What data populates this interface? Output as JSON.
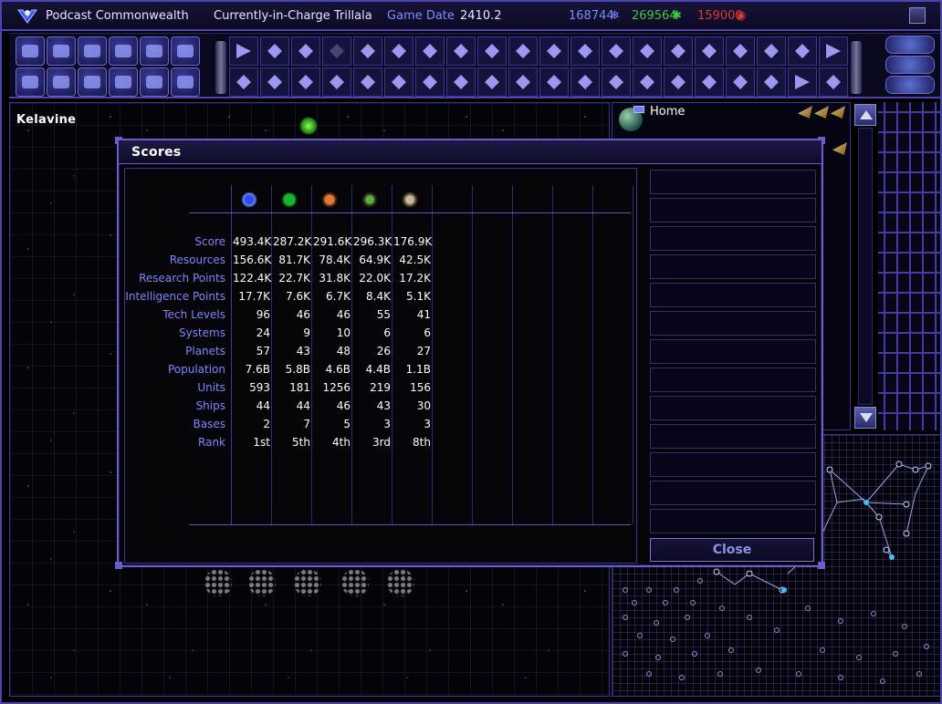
{
  "topbar": {
    "empire_name": "Podcast Commonwealth",
    "leader": "Currently-in-Charge Trillala",
    "game_date_label": "Game Date",
    "game_date_value": "2410.2",
    "resource_minerals": "168744",
    "resource_organics": "269564",
    "resource_radioactives": "159000",
    "colors": {
      "minerals": "#7a8cff",
      "organics": "#3ec93e",
      "radioactives": "#e03a2e"
    }
  },
  "map": {
    "system_name": "Kelavine"
  },
  "side_panel": {
    "home_label": "Home"
  },
  "dialog": {
    "title": "Scores",
    "empire_icons": [
      "commonwealth-emblem-icon",
      "green-empire-emblem-icon",
      "orange-empire-emblem-icon",
      "green-orb-emblem-icon",
      "bird-emblem-icon"
    ],
    "row_labels": [
      "Score",
      "Resources",
      "Research Points",
      "Intelligence Points",
      "Tech Levels",
      "Systems",
      "Planets",
      "Population",
      "Units",
      "Ships",
      "Bases",
      "Rank"
    ],
    "rows": [
      [
        "493.4K",
        "287.2K",
        "291.6K",
        "296.3K",
        "176.9K"
      ],
      [
        "156.6K",
        "81.7K",
        "78.4K",
        "64.9K",
        "42.5K"
      ],
      [
        "122.4K",
        "22.7K",
        "31.8K",
        "22.0K",
        "17.2K"
      ],
      [
        "17.7K",
        "7.6K",
        "6.7K",
        "8.4K",
        "5.1K"
      ],
      [
        "96",
        "46",
        "46",
        "55",
        "41"
      ],
      [
        "24",
        "9",
        "10",
        "6",
        "6"
      ],
      [
        "57",
        "43",
        "48",
        "26",
        "27"
      ],
      [
        "7.6B",
        "5.8B",
        "4.6B",
        "4.4B",
        "1.1B"
      ],
      [
        "593",
        "181",
        "1256",
        "219",
        "156"
      ],
      [
        "44",
        "44",
        "46",
        "43",
        "30"
      ],
      [
        "2",
        "7",
        "5",
        "3",
        "3"
      ],
      [
        "1st",
        "5th",
        "4th",
        "3rd",
        "8th"
      ]
    ],
    "close_label": "Close"
  }
}
